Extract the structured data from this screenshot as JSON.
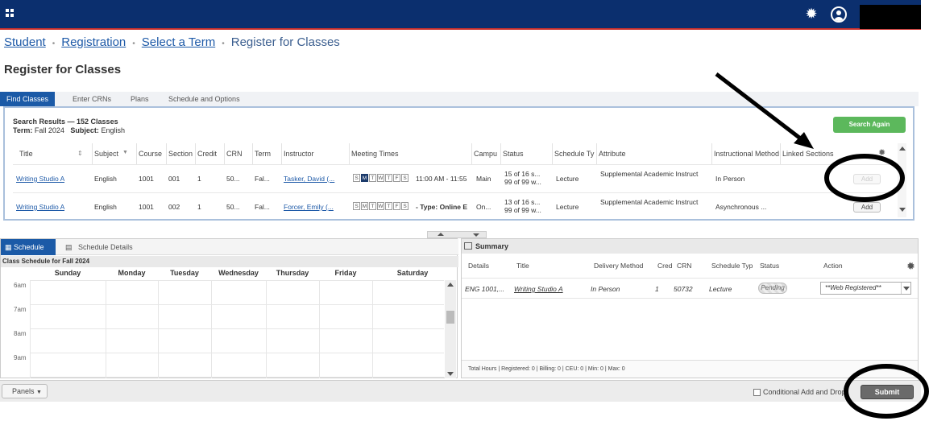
{
  "breadcrumb": {
    "items": [
      "Student",
      "Registration",
      "Select a Term"
    ],
    "current": "Register for Classes"
  },
  "page_title": "Register for Classes",
  "tabs": [
    "Find Classes",
    "Enter CRNs",
    "Plans",
    "Schedule and Options"
  ],
  "results": {
    "title": "Search Results — 152 Classes",
    "term_label": "Term:",
    "term_value": "Fall 2024",
    "subject_label": "Subject:",
    "subject_value": "English",
    "search_again": "Search Again",
    "columns": [
      "Title",
      "Subject",
      "Course",
      "Section",
      "Credit",
      "CRN",
      "Term",
      "Instructor",
      "Meeting Times",
      "Campu",
      "Status",
      "Schedule Ty",
      "Attribute",
      "Instructional Method",
      "Linked Sections"
    ],
    "day_letters": [
      "S",
      "M",
      "T",
      "W",
      "T",
      "F",
      "S"
    ],
    "rows": [
      {
        "title": "Writing Studio A",
        "subject": "English",
        "course": "1001",
        "section": "001",
        "credit": "1",
        "crn": "50...",
        "term": "Fal...",
        "instructor": "Tasker, David (...",
        "meeting": "11:00 AM - 11:55",
        "campus": "Main",
        "status_1": "15 of 16 s...",
        "status_2": "99 of 99 w...",
        "schedule_type": "Lecture",
        "attribute": "Supplemental Academic Instruct",
        "method": "In Person",
        "add": "Add"
      },
      {
        "title": "Writing Studio A",
        "subject": "English",
        "course": "1001",
        "section": "002",
        "credit": "1",
        "crn": "50...",
        "term": "Fal...",
        "instructor": "Forcer, Emily (...",
        "meeting": "- Type: Online E",
        "campus": "On...",
        "status_1": "13 of 16 s...",
        "status_2": "99 of 99 w...",
        "schedule_type": "Lecture",
        "attribute": "Supplemental Academic Instruct",
        "method": "Asynchronous ...",
        "add": "Add"
      }
    ]
  },
  "schedule": {
    "tab_schedule": "Schedule",
    "tab_details": "Schedule Details",
    "title": "Class Schedule for Fall 2024",
    "days": [
      "Sunday",
      "Monday",
      "Tuesday",
      "Wednesday",
      "Thursday",
      "Friday",
      "Saturday"
    ],
    "times": [
      "6am",
      "7am",
      "8am",
      "9am"
    ]
  },
  "summary": {
    "title": "Summary",
    "columns": [
      "Details",
      "Title",
      "Delivery Method",
      "Cred",
      "CRN",
      "Schedule Typ",
      "Status",
      "Action"
    ],
    "row": {
      "details": "ENG 1001,...",
      "title": "Writing Studio A",
      "delivery": "In Person",
      "cred": "1",
      "crn": "50732",
      "schedule_type": "Lecture",
      "status": "Pending",
      "action": "**Web Registered**"
    },
    "totals": "Total Hours | Registered: 0 | Billing: 0 | CEU: 0 | Min: 0 | Max: 0"
  },
  "footer": {
    "panels": "Panels",
    "conditional": "Conditional Add and Drop",
    "submit": "Submit"
  },
  "colors": {
    "topbar": "#0b2f6e",
    "accent_red": "#c9302c",
    "tab_active": "#1b5aa7",
    "search_again": "#5cb85c"
  }
}
